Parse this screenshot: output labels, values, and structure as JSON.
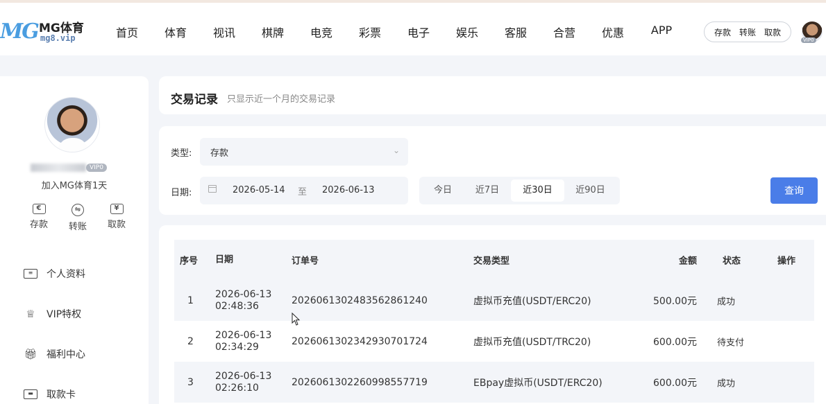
{
  "header": {
    "logo_mark": "MG",
    "logo_name": "MG体育",
    "logo_domain": "mg8.vip",
    "nav": [
      "首页",
      "体育",
      "视讯",
      "棋牌",
      "电竞",
      "彩票",
      "电子",
      "娱乐",
      "客服",
      "合营",
      "优惠",
      "APP"
    ],
    "wallet": {
      "deposit": "存款",
      "transfer": "转账",
      "withdraw": "取款"
    },
    "avatar_vip": "VIP0"
  },
  "sidebar": {
    "vip_badge": "VIP0",
    "join_text": "加入MG体育1天",
    "quick_actions": [
      {
        "label": "存款",
        "icon": "deposit-icon"
      },
      {
        "label": "转账",
        "icon": "transfer-icon"
      },
      {
        "label": "取款",
        "icon": "withdraw-icon"
      }
    ],
    "menu": [
      {
        "label": "个人资料",
        "icon": "profile-card-icon"
      },
      {
        "label": "VIP特权",
        "icon": "crown-icon"
      },
      {
        "label": "福利中心",
        "icon": "gift-icon"
      },
      {
        "label": "取款卡",
        "icon": "bank-card-icon"
      }
    ]
  },
  "page": {
    "title": "交易记录",
    "subtitle": "只显示近一个月的交易记录"
  },
  "filters": {
    "type_label": "类型:",
    "type_value": "存款",
    "date_label": "日期:",
    "date_from": "2026-05-14",
    "date_sep": "至",
    "date_to": "2026-06-13",
    "quick_ranges": [
      "今日",
      "近7日",
      "近30日",
      "近90日"
    ],
    "active_range": "近30日",
    "search_label": "查询"
  },
  "table": {
    "headers": {
      "idx": "序号",
      "date": "日期",
      "order": "订单号",
      "type": "交易类型",
      "amount": "金额",
      "status": "状态",
      "op": "操作"
    },
    "rows": [
      {
        "idx": "1",
        "date": "2026-06-13",
        "time": "02:48:36",
        "order": "202606130248356286124​0",
        "type": "虚拟币充值(USDT/ERC20)",
        "amount": "500.00元",
        "status": "成功"
      },
      {
        "idx": "2",
        "date": "2026-06-13",
        "time": "02:34:29",
        "order": "2026061302342930701724",
        "type": "虚拟币充值(USDT/TRC20)",
        "amount": "600.00元",
        "status": "待支付"
      },
      {
        "idx": "3",
        "date": "2026-06-13",
        "time": "02:26:10",
        "order": "2026061302260998557719",
        "type": "EBpay虚拟币(USDT/ERC20)",
        "amount": "600.00元",
        "status": "成功"
      }
    ]
  }
}
